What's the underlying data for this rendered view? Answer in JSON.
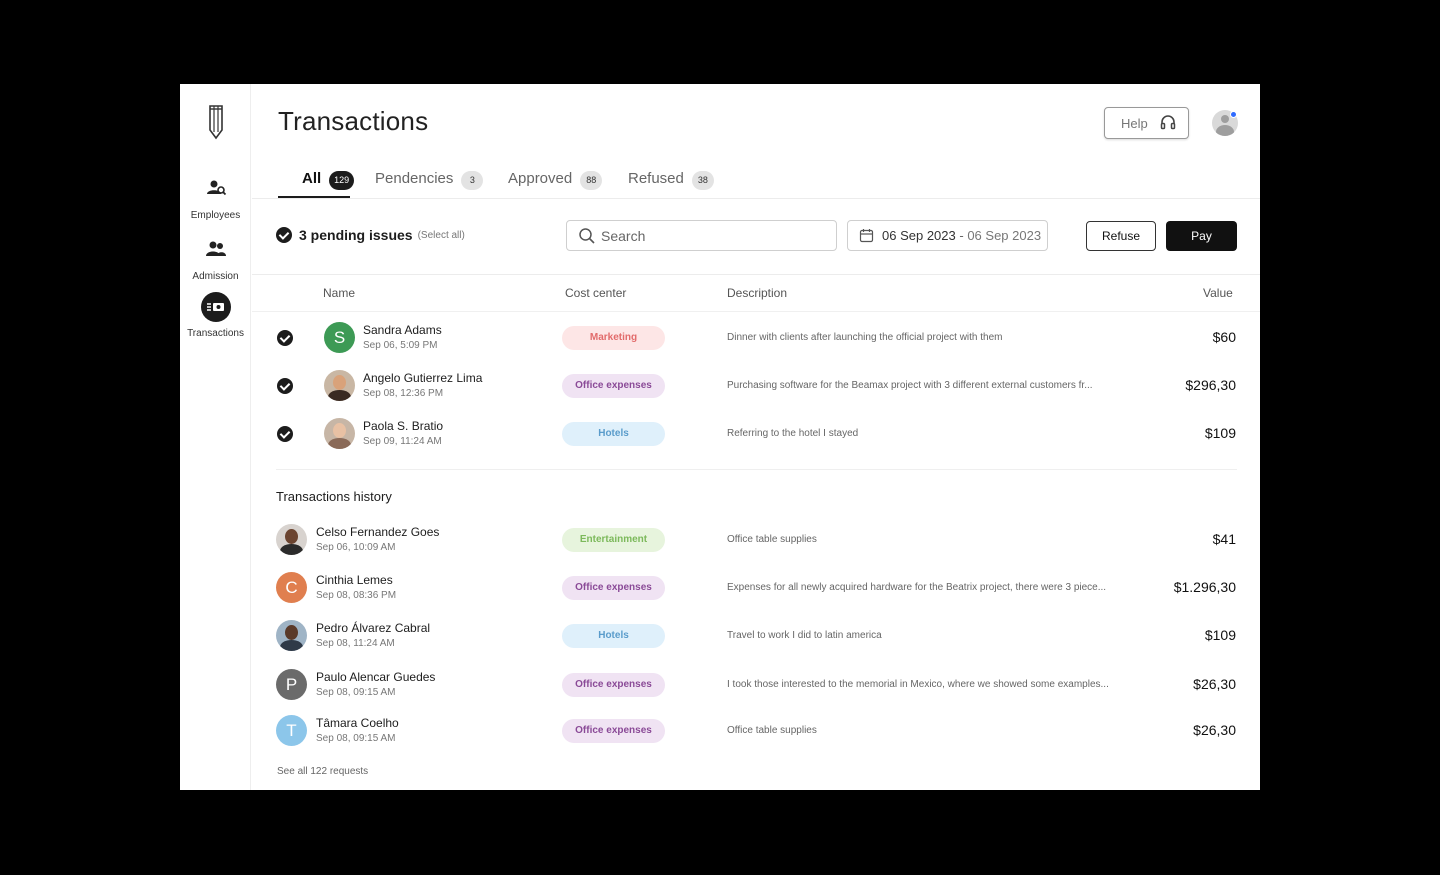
{
  "sidebar": {
    "items": [
      {
        "label": "Employees",
        "icon": "employees-search-icon"
      },
      {
        "label": "Admission",
        "icon": "people-icon"
      },
      {
        "label": "Transactions",
        "icon": "money-transfer-icon"
      }
    ]
  },
  "header": {
    "title": "Transactions",
    "help_label": "Help"
  },
  "tabs": [
    {
      "label": "All",
      "count": "129"
    },
    {
      "label": "Pendencies",
      "count": "3"
    },
    {
      "label": "Approved",
      "count": "88"
    },
    {
      "label": "Refused",
      "count": "38"
    }
  ],
  "toolbar": {
    "pending_label": "3 pending issues",
    "select_all": "(Select all)",
    "search_placeholder": "Search",
    "date_from": "06 Sep 2023",
    "date_sep": "-",
    "date_to": "06 Sep 2023",
    "refuse_label": "Refuse",
    "pay_label": "Pay"
  },
  "table": {
    "headers": {
      "name": "Name",
      "cost_center": "Cost center",
      "description": "Description",
      "value": "Value"
    }
  },
  "pending_rows": [
    {
      "name": "Sandra Adams",
      "date": "Sep 06, 5:09 PM",
      "initial": "S",
      "avatar_color": "#3d9a55",
      "tag": "Marketing",
      "tag_class": "marketing",
      "description": "Dinner with clients after launching the official project with them",
      "value": "$60"
    },
    {
      "name": "Angelo Gutierrez Lima",
      "date": "Sep 08, 12:36 PM",
      "initial": "",
      "avatar_color": "#a0704a",
      "tag": "Office expenses",
      "tag_class": "office",
      "description": "Purchasing software for the Beamax project with 3 different external customers fr...",
      "value": "$296,30"
    },
    {
      "name": "Paola S. Bratio",
      "date": "Sep 09, 11:24 AM",
      "initial": "",
      "avatar_color": "#c79a7c",
      "tag": "Hotels",
      "tag_class": "hotels",
      "description": "Referring to the hotel I stayed",
      "value": "$109"
    }
  ],
  "history": {
    "title": "Transactions history",
    "rows": [
      {
        "name": "Celso Fernandez Goes",
        "date": "Sep 06, 10:09 AM",
        "initial": "",
        "avatar_color": "#5a3a2a",
        "tag": "Entertainment",
        "tag_class": "entertainment",
        "description": "Office table supplies",
        "value": "$41"
      },
      {
        "name": "Cinthia Lemes",
        "date": "Sep 08, 08:36 PM",
        "initial": "C",
        "avatar_color": "#e07f4f",
        "tag": "Office expenses",
        "tag_class": "office",
        "description": "Expenses for all newly acquired hardware for the Beatrix project, there were 3 piece...",
        "value": "$1.296,30"
      },
      {
        "name": "Pedro Álvarez Cabral",
        "date": "Sep 08, 11:24 AM",
        "initial": "",
        "avatar_color": "#4a3428",
        "tag": "Hotels",
        "tag_class": "hotels",
        "description": "Travel to work I did to latin america",
        "value": "$109"
      },
      {
        "name": "Paulo Alencar Guedes",
        "date": "Sep 08, 09:15 AM",
        "initial": "P",
        "avatar_color": "#6b6b6b",
        "tag": "Office expenses",
        "tag_class": "office",
        "description": "I took those interested to the memorial in Mexico, where we showed some examples...",
        "value": "$26,30"
      },
      {
        "name": "Tâmara Coelho",
        "date": "Sep 08, 09:15 AM",
        "initial": "T",
        "avatar_color": "#8cc6ea",
        "tag": "Office expenses",
        "tag_class": "office",
        "description": "Office table supplies",
        "value": "$26,30"
      }
    ],
    "see_all": "See all 122 requests"
  }
}
